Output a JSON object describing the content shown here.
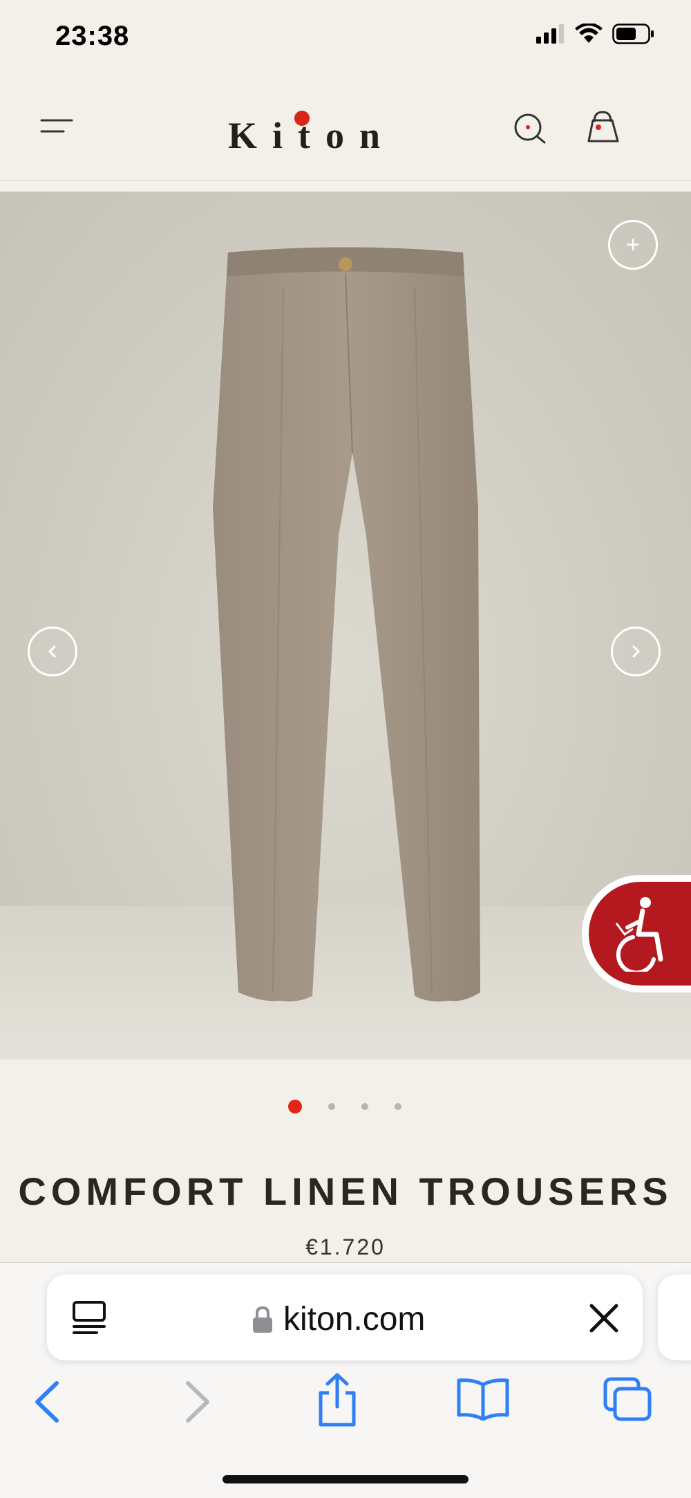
{
  "status_bar": {
    "time": "23:38",
    "icons": [
      "signal-icon",
      "wifi-icon",
      "battery-icon"
    ]
  },
  "header": {
    "logo": "Kiton",
    "icons": [
      "menu-icon",
      "search-icon",
      "shopping-bag-icon"
    ]
  },
  "gallery": {
    "zoom_label": "+",
    "slide_count": 4,
    "active_slide": 1
  },
  "product": {
    "title": "COMFORT LINEN TROUSERS",
    "price": "€1.720"
  },
  "browser": {
    "url": "kiton.com",
    "toolbar_icons": [
      "back-icon",
      "forward-icon",
      "share-icon",
      "bookmarks-icon",
      "tabs-icon"
    ]
  },
  "colors": {
    "accent": "#e3261c",
    "accessibility_bg": "#b3191f",
    "page_bg": "#f3efe9",
    "ios_blue": "#2f7ff5"
  }
}
